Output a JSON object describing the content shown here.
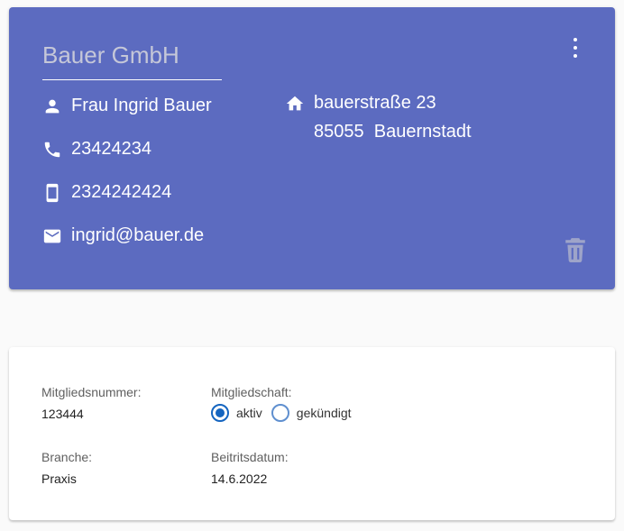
{
  "header": {
    "company": "Bauer GmbH",
    "contact_name": "Frau Ingrid Bauer",
    "phone": "23424234",
    "mobile": "2324242424",
    "email": "ingrid@bauer.de",
    "street": "bauerstraße 23",
    "zip": "85055",
    "city": "Bauernstadt",
    "accent_color": "#5c6bc0"
  },
  "details": {
    "member_number_label": "Mitgliedsnummer:",
    "member_number": "123444",
    "membership_label": "Mitgliedschaft:",
    "membership_options": [
      "aktiv",
      "gekündigt"
    ],
    "membership_selected": "aktiv",
    "branch_label": "Branche:",
    "branch": "Praxis",
    "join_date_label": "Beitritsdatum:",
    "join_date": "14.6.2022"
  }
}
